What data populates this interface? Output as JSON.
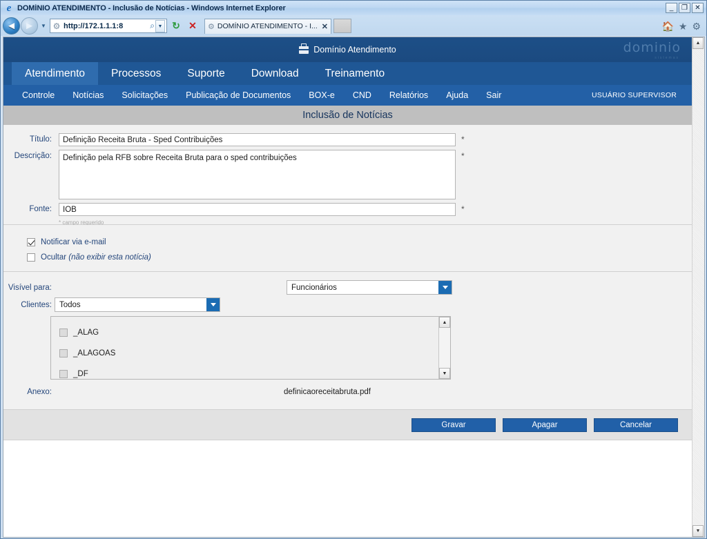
{
  "browser": {
    "title": "DOMÍNIO ATENDIMENTO - Inclusão de Notícias - Windows Internet Explorer",
    "url": "http://172.1.1.1:8",
    "tab_label": "DOMÍNIO ATENDIMENTO - I...",
    "tab_close": "✕",
    "window_controls": {
      "minimize": "_",
      "maximize": "❐",
      "close": "✕"
    },
    "nav": {
      "back": "◄",
      "forward": "►",
      "dropdown": "▼",
      "refresh": "↻",
      "stop": "✕",
      "search": "⌕",
      "caret": "▼"
    },
    "chrome_icons": {
      "home": "home-icon",
      "favorites": "favorites-icon",
      "tools": "tools-icon"
    }
  },
  "app": {
    "header_title": "Domínio Atendimento",
    "brand_name": "dominio",
    "brand_sub": "sistemas",
    "primary_nav": [
      {
        "label": "Atendimento",
        "active": true
      },
      {
        "label": "Processos",
        "active": false
      },
      {
        "label": "Suporte",
        "active": false
      },
      {
        "label": "Download",
        "active": false
      },
      {
        "label": "Treinamento",
        "active": false
      }
    ],
    "secondary_nav": [
      {
        "label": "Controle"
      },
      {
        "label": "Notícias"
      },
      {
        "label": "Solicitações"
      },
      {
        "label": "Publicação de Documentos"
      },
      {
        "label": "BOX-e"
      },
      {
        "label": "CND"
      },
      {
        "label": "Relatórios"
      },
      {
        "label": "Ajuda"
      },
      {
        "label": "Sair"
      }
    ],
    "user": "USUÁRIO SUPERVISOR",
    "page_title": "Inclusão de Notícias"
  },
  "form": {
    "titulo_label": "Título:",
    "titulo_value": "Definição Receita Bruta - Sped Contribuições",
    "descricao_label": "Descrição:",
    "descricao_value": "Definição pela RFB sobre Receita Bruta para o sped contribuições",
    "fonte_label": "Fonte:",
    "fonte_value": "IOB",
    "required_marker": "*",
    "required_note": "* campo requerido",
    "notificar_label": "Notificar via e-mail",
    "notificar_checked": true,
    "ocultar_label": "Ocultar ",
    "ocultar_hint": "(não exibir esta notícia)",
    "ocultar_checked": false,
    "visivel_label": "Visível para:",
    "visivel_value": "Funcionários",
    "clientes_label": "Clientes:",
    "clientes_value": "Todos",
    "client_list": [
      {
        "label": "_ALAG",
        "checked": false
      },
      {
        "label": "_ALAGOAS",
        "checked": false
      },
      {
        "label": "_DF",
        "checked": false
      }
    ],
    "anexo_label": "Anexo:",
    "anexo_file": "definicaoreceitabruta.pdf",
    "scroll_up": "▲",
    "scroll_down": "▼"
  },
  "actions": {
    "gravar": "Gravar",
    "apagar": "Apagar",
    "cancelar": "Cancelar"
  },
  "colors": {
    "header_blue": "#1d4f87",
    "primary_nav_blue": "#1f5795",
    "active_tab_blue": "#2f6cae",
    "secondary_nav_blue": "#2360a6",
    "button_blue": "#2160a8",
    "label_blue": "#23457a",
    "title_band_grey": "#bfbfbf",
    "section_grey": "#f1f1f1"
  }
}
